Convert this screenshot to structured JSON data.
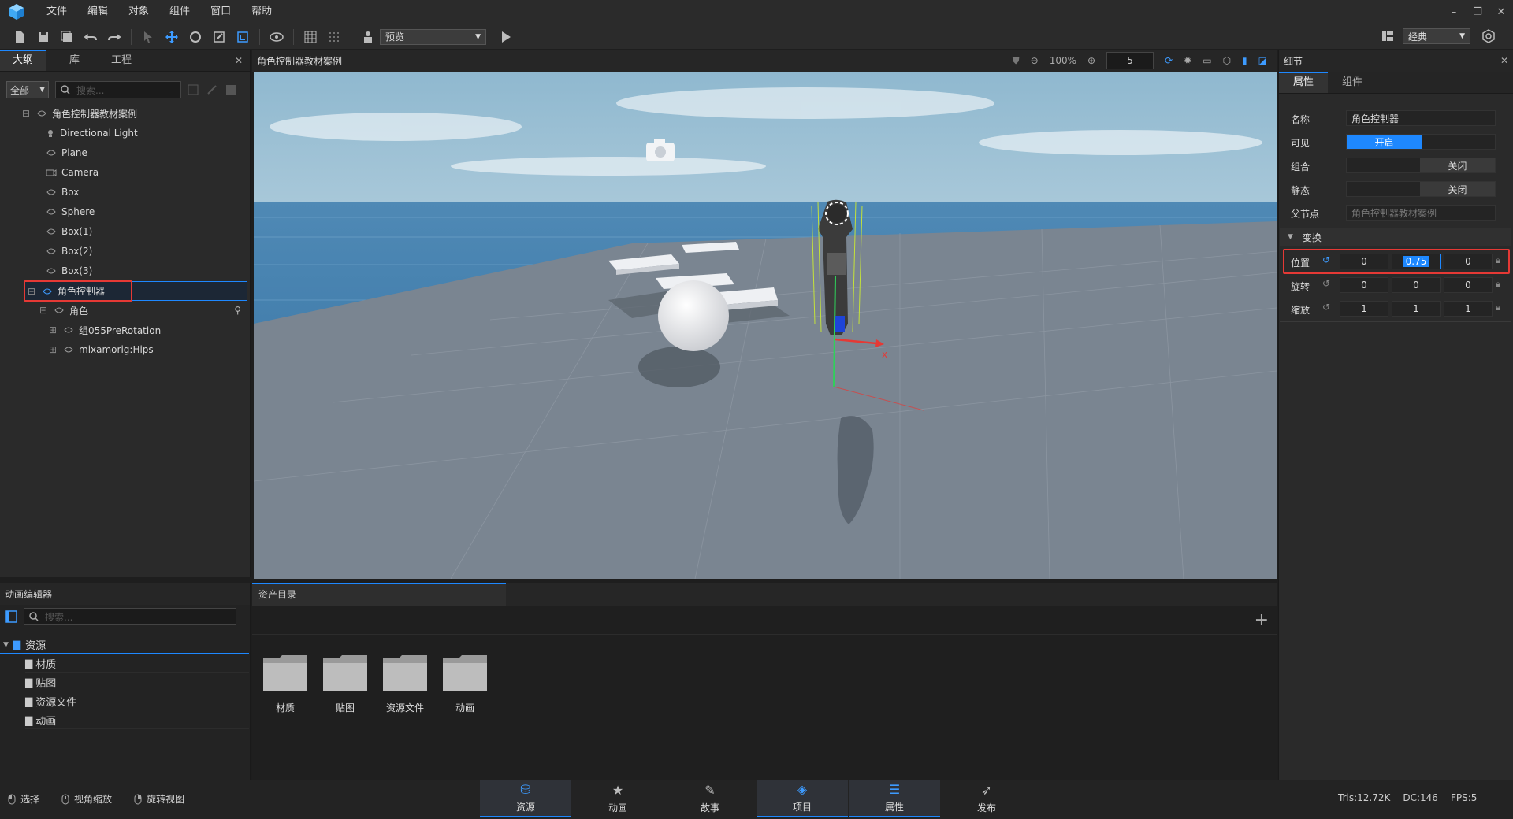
{
  "menubar": {
    "items": [
      "文件",
      "编辑",
      "对象",
      "组件",
      "窗口",
      "帮助"
    ]
  },
  "toolbar": {
    "preview_label": "预览",
    "layout_label": "经典"
  },
  "outline": {
    "tabs": [
      "大纲",
      "库",
      "工程"
    ],
    "filter_label": "全部",
    "search_placeholder": "搜索...",
    "tree": [
      {
        "label": "角色控制器教材案例"
      },
      {
        "label": "Directional Light"
      },
      {
        "label": "Plane"
      },
      {
        "label": "Camera"
      },
      {
        "label": "Box"
      },
      {
        "label": "Sphere"
      },
      {
        "label": "Box(1)"
      },
      {
        "label": "Box(2)"
      },
      {
        "label": "Box(3)"
      },
      {
        "label": "角色控制器"
      },
      {
        "label": "角色"
      },
      {
        "label": "组055PreRotation"
      },
      {
        "label": "mixamorig:Hips"
      }
    ]
  },
  "viewport": {
    "title": "角色控制器教材案例",
    "zoom": "100%",
    "speed": "5",
    "axis_label": "x"
  },
  "details": {
    "title": "细节",
    "tabs": [
      "属性",
      "组件"
    ],
    "name_label": "名称",
    "name_value": "角色控制器",
    "visible_label": "可见",
    "visible_value": "开启",
    "group_label": "组合",
    "group_value": "关闭",
    "static_label": "静态",
    "static_value": "关闭",
    "parent_label": "父节点",
    "parent_value": "角色控制器教材案例",
    "transform_label": "变换",
    "position_label": "位置",
    "position": [
      "0",
      "0.75",
      "0"
    ],
    "rotation_label": "旋转",
    "rotation": [
      "0",
      "0",
      "0"
    ],
    "scale_label": "缩放",
    "scale": [
      "1",
      "1",
      "1"
    ]
  },
  "anim_editor": {
    "title": "动画编辑器",
    "search_placeholder": "搜索...",
    "root": "资源",
    "children": [
      "材质",
      "贴图",
      "资源文件",
      "动画"
    ]
  },
  "assets": {
    "title": "资产目录",
    "folders": [
      "材质",
      "贴图",
      "资源文件",
      "动画"
    ]
  },
  "statusbar": {
    "tools": [
      "选择",
      "视角缩放",
      "旋转视图"
    ],
    "tabs": [
      "资源",
      "动画",
      "故事",
      "项目",
      "属性",
      "发布"
    ],
    "stats": {
      "tris": "Tris:12.72K",
      "dc": "DC:146",
      "fps": "FPS:5"
    }
  },
  "colors": {
    "accent": "#1e88ff",
    "highlight": "#e53935"
  }
}
